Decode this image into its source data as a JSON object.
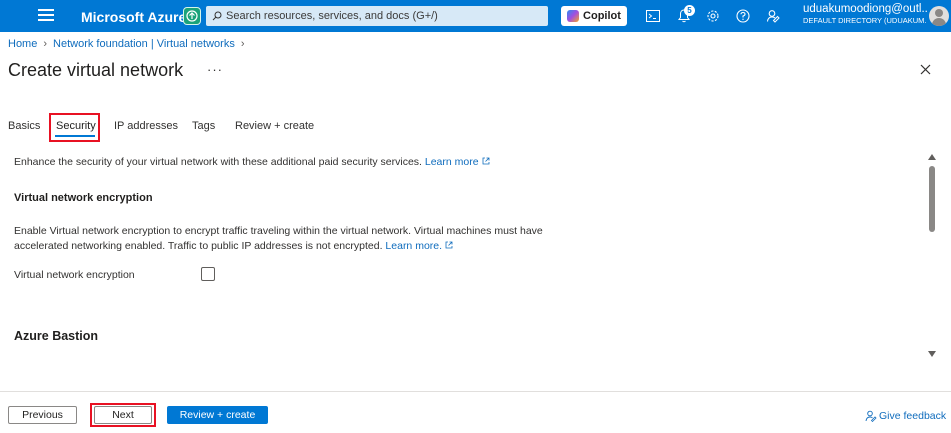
{
  "topbar": {
    "brand": "Microsoft Azure",
    "search_placeholder": "Search resources, services, and docs (G+/)",
    "copilot_label": "Copilot",
    "notification_count": "5",
    "account_name": "uduakumoodiong@outl...",
    "account_directory": "DEFAULT DIRECTORY (UDUAKUM...",
    "icons": [
      "menu-icon",
      "upgrade-icon",
      "search-icon",
      "copilot-icon",
      "cloud-shell-icon",
      "notifications-icon",
      "settings-icon",
      "help-icon",
      "feedback-icon",
      "avatar"
    ]
  },
  "breadcrumb": {
    "items": [
      "Home",
      "Network foundation | Virtual networks"
    ]
  },
  "page": {
    "title": "Create virtual network",
    "more": "···"
  },
  "tabs": [
    {
      "label": "Basics",
      "active": false
    },
    {
      "label": "Security",
      "active": true
    },
    {
      "label": "IP addresses",
      "active": false
    },
    {
      "label": "Tags",
      "active": false
    },
    {
      "label": "Review + create",
      "active": false
    }
  ],
  "content": {
    "intro_text": "Enhance the security of your virtual network with these additional paid security services.",
    "intro_link": "Learn more",
    "encryption_heading": "Virtual network encryption",
    "encryption_desc": "Enable Virtual network encryption to encrypt traffic traveling within the virtual network. Virtual machines must have accelerated networking enabled. Traffic to public IP addresses is not encrypted.",
    "encryption_link": "Learn more.",
    "encryption_field_label": "Virtual network encryption",
    "encryption_checked": false,
    "bastion_heading": "Azure Bastion"
  },
  "footer": {
    "previous_label": "Previous",
    "next_label": "Next",
    "review_label": "Review + create",
    "feedback_label": "Give feedback"
  },
  "colors": {
    "topbar": "#0078d4",
    "link": "#0f6cbd",
    "highlight": "#e81123",
    "primary_button": "#0078d4"
  }
}
